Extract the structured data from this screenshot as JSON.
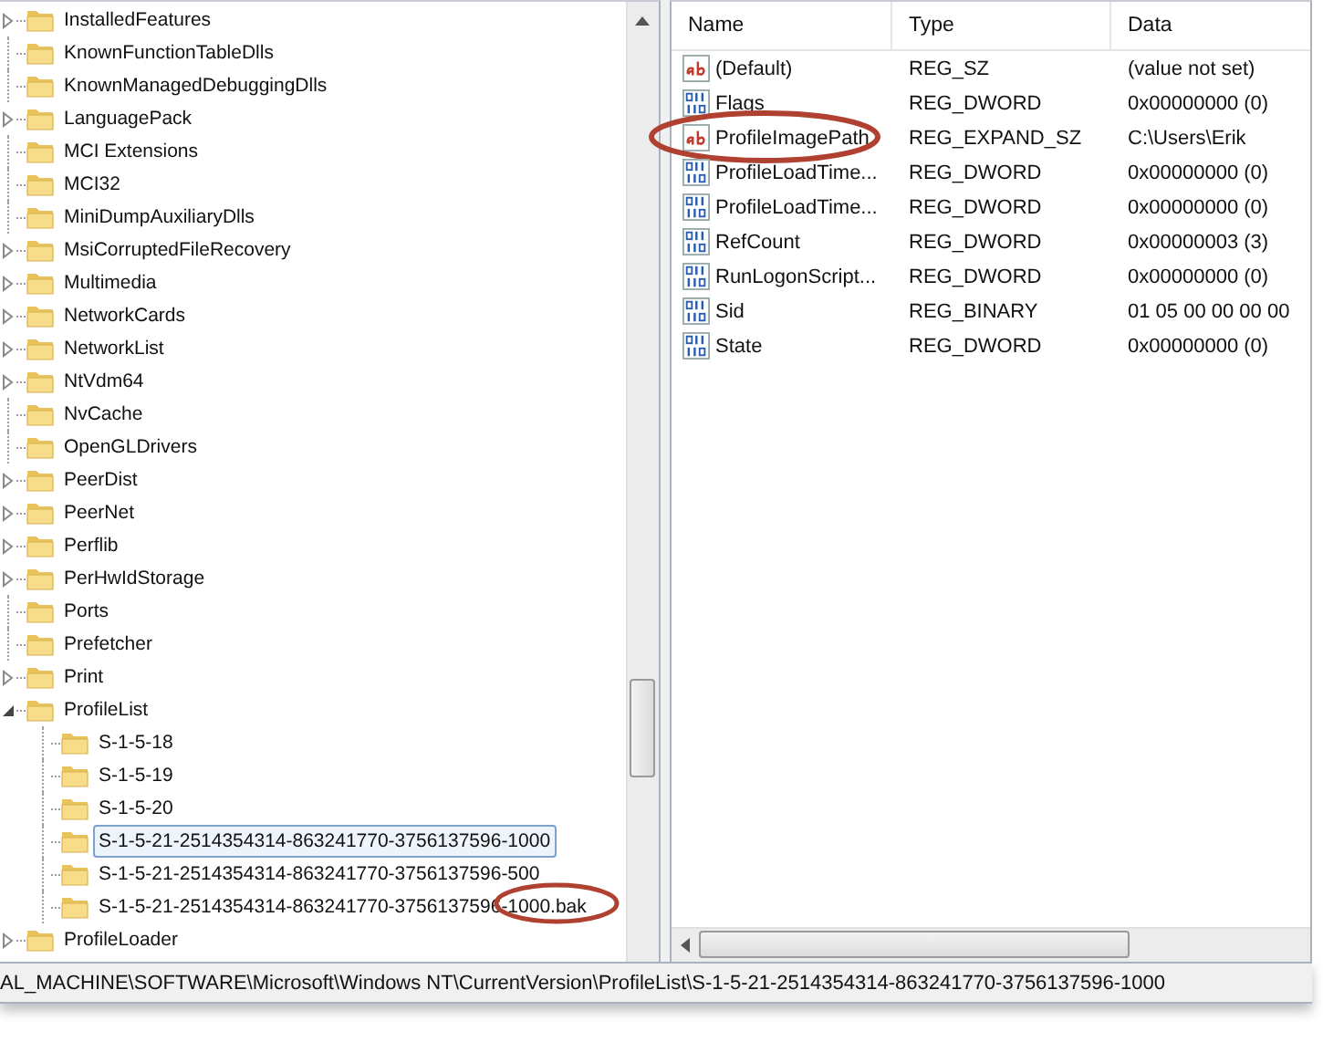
{
  "tree": {
    "items": [
      {
        "label": "InstalledFeatures",
        "expanded": false,
        "selected": false
      },
      {
        "label": "KnownFunctionTableDlls",
        "selected": false
      },
      {
        "label": "KnownManagedDebuggingDlls",
        "selected": false
      },
      {
        "label": "LanguagePack",
        "expanded": false,
        "selected": false
      },
      {
        "label": "MCI Extensions",
        "selected": false
      },
      {
        "label": "MCI32",
        "selected": false
      },
      {
        "label": "MiniDumpAuxiliaryDlls",
        "selected": false
      },
      {
        "label": "MsiCorruptedFileRecovery",
        "expanded": false,
        "selected": false
      },
      {
        "label": "Multimedia",
        "expanded": false,
        "selected": false
      },
      {
        "label": "NetworkCards",
        "expanded": false,
        "selected": false
      },
      {
        "label": "NetworkList",
        "expanded": false,
        "selected": false
      },
      {
        "label": "NtVdm64",
        "expanded": false,
        "selected": false
      },
      {
        "label": "NvCache",
        "selected": false
      },
      {
        "label": "OpenGLDrivers",
        "selected": false
      },
      {
        "label": "PeerDist",
        "expanded": false,
        "selected": false
      },
      {
        "label": "PeerNet",
        "expanded": false,
        "selected": false
      },
      {
        "label": "Perflib",
        "expanded": false,
        "selected": false
      },
      {
        "label": "PerHwIdStorage",
        "expanded": false,
        "selected": false
      },
      {
        "label": "Ports",
        "selected": false
      },
      {
        "label": "Prefetcher",
        "selected": false
      },
      {
        "label": "Print",
        "expanded": false,
        "selected": false
      },
      {
        "label": "ProfileList",
        "expanded": true,
        "selected": false,
        "children": [
          {
            "label": "S-1-5-18",
            "selected": false
          },
          {
            "label": "S-1-5-19",
            "selected": false
          },
          {
            "label": "S-1-5-20",
            "selected": false
          },
          {
            "label": "S-1-5-21-2514354314-863241770-3756137596-1000",
            "selected": true
          },
          {
            "label": "S-1-5-21-2514354314-863241770-3756137596-500",
            "selected": false
          },
          {
            "label": "S-1-5-21-2514354314-863241770-3756137596-1000.bak",
            "selected": false,
            "circled": true
          }
        ]
      },
      {
        "label": "ProfileLoader",
        "expanded": false,
        "selected": false
      }
    ]
  },
  "values": {
    "columns": [
      "Name",
      "Type",
      "Data"
    ],
    "rows": [
      {
        "kind": "string",
        "name": "(Default)",
        "type": "REG_SZ",
        "data": "(value not set)"
      },
      {
        "kind": "binary",
        "name": "Flags",
        "type": "REG_DWORD",
        "data": "0x00000000 (0)"
      },
      {
        "kind": "string",
        "name": "ProfileImagePath",
        "type": "REG_EXPAND_SZ",
        "data": "C:\\Users\\Erik",
        "circled": true
      },
      {
        "kind": "binary",
        "name": "ProfileLoadTime...",
        "type": "REG_DWORD",
        "data": "0x00000000 (0)"
      },
      {
        "kind": "binary",
        "name": "ProfileLoadTime...",
        "type": "REG_DWORD",
        "data": "0x00000000 (0)"
      },
      {
        "kind": "binary",
        "name": "RefCount",
        "type": "REG_DWORD",
        "data": "0x00000003 (3)"
      },
      {
        "kind": "binary",
        "name": "RunLogonScript...",
        "type": "REG_DWORD",
        "data": "0x00000000 (0)"
      },
      {
        "kind": "binary",
        "name": "Sid",
        "type": "REG_BINARY",
        "data": "01 05 00 00 00 00"
      },
      {
        "kind": "binary",
        "name": "State",
        "type": "REG_DWORD",
        "data": "0x00000000 (0)"
      }
    ]
  },
  "status_bar": {
    "path": "AL_MACHINE\\SOFTWARE\\Microsoft\\Windows NT\\CurrentVersion\\ProfileList\\S-1-5-21-2514354314-863241770-3756137596-1000"
  }
}
